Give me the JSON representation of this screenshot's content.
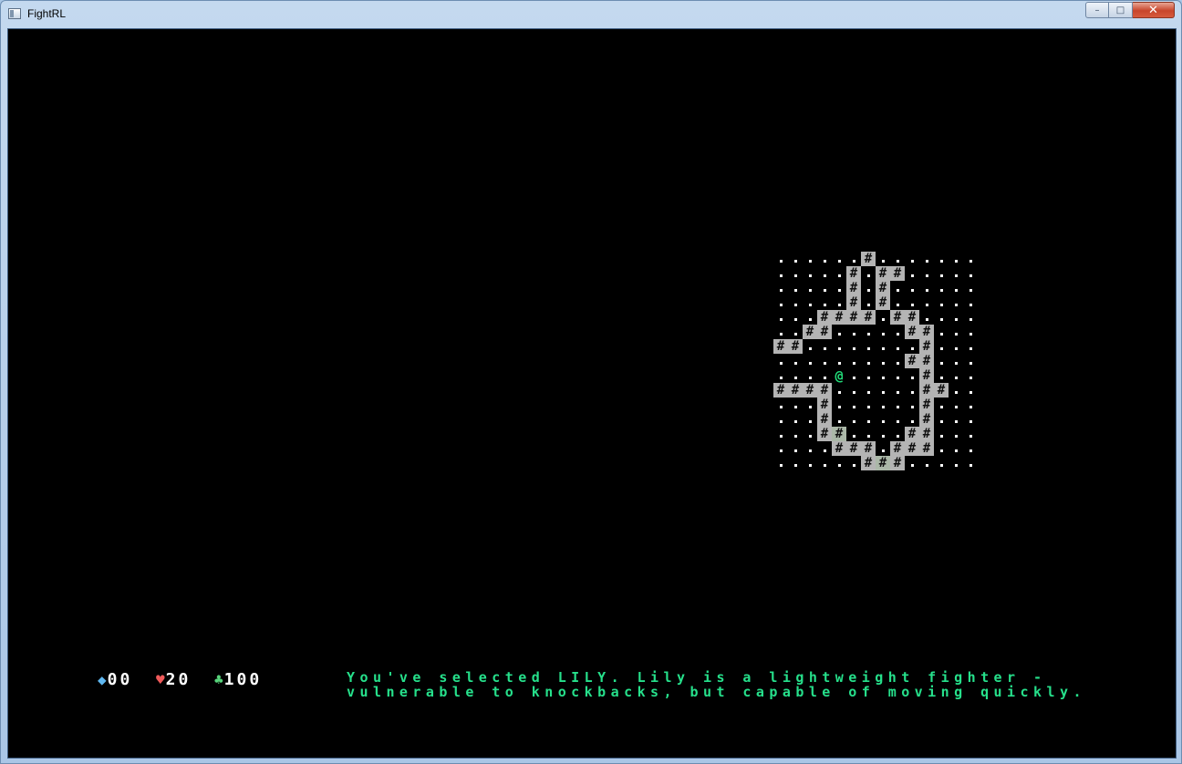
{
  "window": {
    "title": "FightRL",
    "minimize_glyph": "–",
    "maximize_glyph": "□",
    "close_glyph": "✕"
  },
  "hud": {
    "gems": {
      "icon": "diamond-icon",
      "glyph": "◆",
      "value": "00",
      "color": "#5fb7f0"
    },
    "health": {
      "icon": "heart-icon",
      "glyph": "♥",
      "value": "20",
      "color": "#ef5a5a"
    },
    "clubs": {
      "icon": "club-icon",
      "glyph": "♣",
      "value": "100",
      "color": "#57d47b"
    }
  },
  "message": {
    "line1": "You've selected LILY. Lily is a lightweight fighter -",
    "line2": "vulnerable to knockbacks, but capable of moving quickly.",
    "color": "#26e08b"
  },
  "map": {
    "wall_glyph": "#",
    "player_glyph": "@",
    "player_color": "#22dd7a",
    "rows": [
      "......#.......",
      ".....#.##.....",
      ".....#.#......",
      ".....#.#......",
      "...####.##....",
      "..##.....##...",
      "##........#...",
      ".........##...",
      "....@.....#...",
      "####......##..",
      "...#......#...",
      "...#......#...",
      "...##....##...",
      "....###.###...",
      "......###....."
    ]
  }
}
